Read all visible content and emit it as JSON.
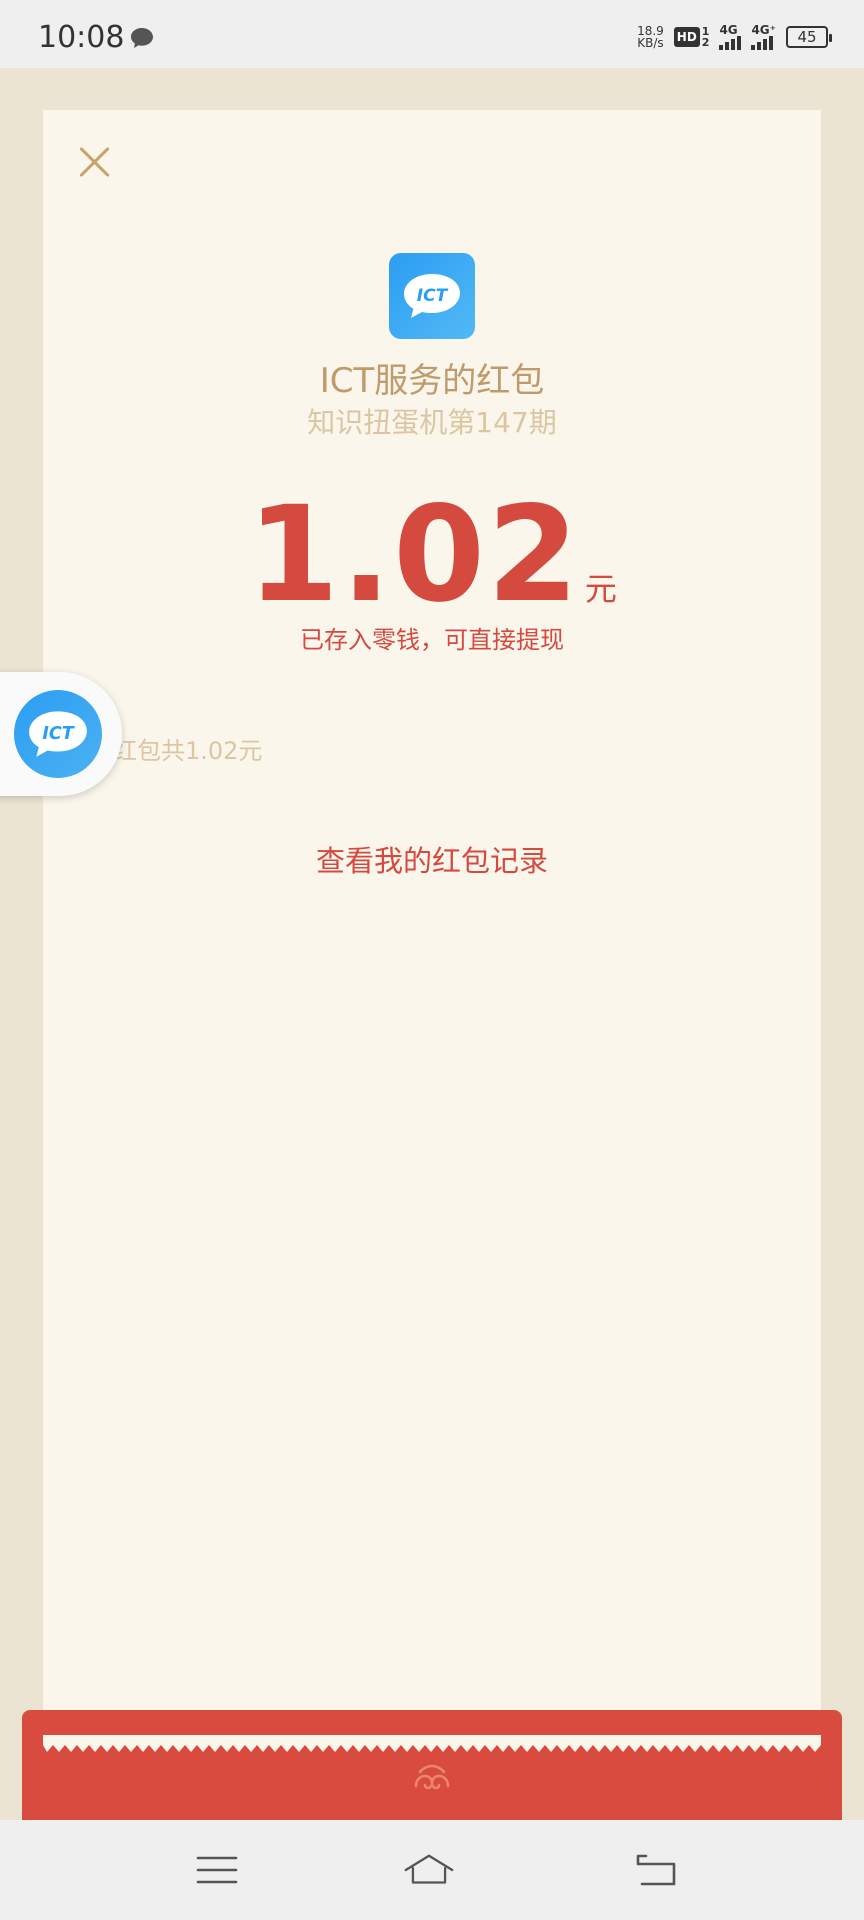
{
  "status_bar": {
    "time": "10:08",
    "net_speed_value": "18.9",
    "net_speed_unit": "KB/s",
    "hd_label": "HD",
    "hd_sim_1": "1",
    "hd_sim_2": "2",
    "signal_1_label": "4G",
    "signal_2_label": "4G⁺",
    "battery": "45"
  },
  "red_packet": {
    "sender_name": "ICT服务的红包",
    "subtitle": "知识扭蛋机第147期",
    "amount": "1.02",
    "amount_unit": "元",
    "saved_note": "已存入零钱，可直接提现",
    "total_note": "红包共1.02元",
    "record_link": "查看我的红包记录",
    "logo_text": "ICT"
  },
  "colors": {
    "accent_red": "#d44a3f",
    "gold_text": "#c19a6b",
    "card_bg": "#faf6ec",
    "page_bg": "#ebe4d2",
    "logo_blue": "#2b9df2"
  },
  "icons": {
    "close": "close-icon",
    "message": "message-icon",
    "menu": "menu-icon",
    "home": "home-icon",
    "back": "back-icon"
  }
}
